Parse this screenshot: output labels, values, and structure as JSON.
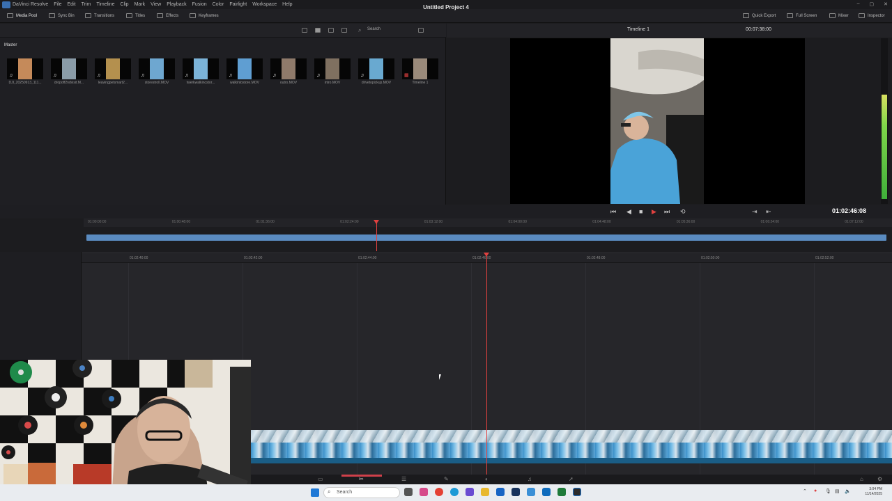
{
  "menu": [
    "DaVinci Resolve",
    "File",
    "Edit",
    "Trim",
    "Timeline",
    "Clip",
    "Mark",
    "View",
    "Playback",
    "Fusion",
    "Color",
    "Fairlight",
    "Workspace",
    "Help"
  ],
  "toolbar": {
    "left": [
      "Media Pool",
      "Sync Bin",
      "Transitions",
      "Titles",
      "Effects",
      "Keyframes"
    ],
    "project_title": "Untitled Project 4",
    "right": [
      "Quick Export",
      "Full Screen",
      "Mixer",
      "Inspector"
    ]
  },
  "pool": {
    "search_placeholder": "Search",
    "bin": "Master",
    "clips": [
      {
        "name": "DJI_20250913_111...",
        "color": "#c58a5a",
        "audio": true
      },
      {
        "name": "dropoff2ndvisit.M...",
        "color": "#8a9ca8",
        "audio": true
      },
      {
        "name": "leavingpetsmart2...",
        "color": "#b4904e",
        "audio": true
      },
      {
        "name": "storestroll.MOV",
        "color": "#6ea7d0",
        "audio": true
      },
      {
        "name": "twerkwalkincstor...",
        "color": "#7bb3d8",
        "audio": true
      },
      {
        "name": "walkintostore.MOV",
        "color": "#5f9ed2",
        "audio": true
      },
      {
        "name": "outro.MOV",
        "color": "#8f7a6a",
        "audio": true
      },
      {
        "name": "intro.MOV",
        "color": "#7f7060",
        "audio": true
      },
      {
        "name": "drivetopickup.MOV",
        "color": "#69a9d0",
        "audio": true
      },
      {
        "name": "Timeline 1",
        "color": "#9a8a7a",
        "audio": false
      }
    ]
  },
  "viewer": {
    "timeline_name": "Timeline 1",
    "duration": "00:07:38:00",
    "timecode": "01:02:46:08"
  },
  "ruler_upper": [
    "01:00:00:00",
    "01:00:48:00",
    "01:01:36:00",
    "01:02:24:00",
    "01:03:12:00",
    "01:04:00:00",
    "01:04:48:00",
    "01:05:36:00",
    "01:06:24:00",
    "01:07:12:00"
  ],
  "ruler_lower": [
    "01:02:40:00",
    "01:02:42:00",
    "01:02:44:00",
    "01:02:46:00",
    "01:02:48:00",
    "01:02:50:00",
    "01:02:52:00"
  ],
  "taskbar": {
    "search": "Search",
    "time": "3:04 PM",
    "date": "11/14/2025"
  },
  "colors": {
    "playhead": "#e0413f",
    "clip_blue": "#5a8bc0",
    "accent_tab": "#d0404a"
  }
}
